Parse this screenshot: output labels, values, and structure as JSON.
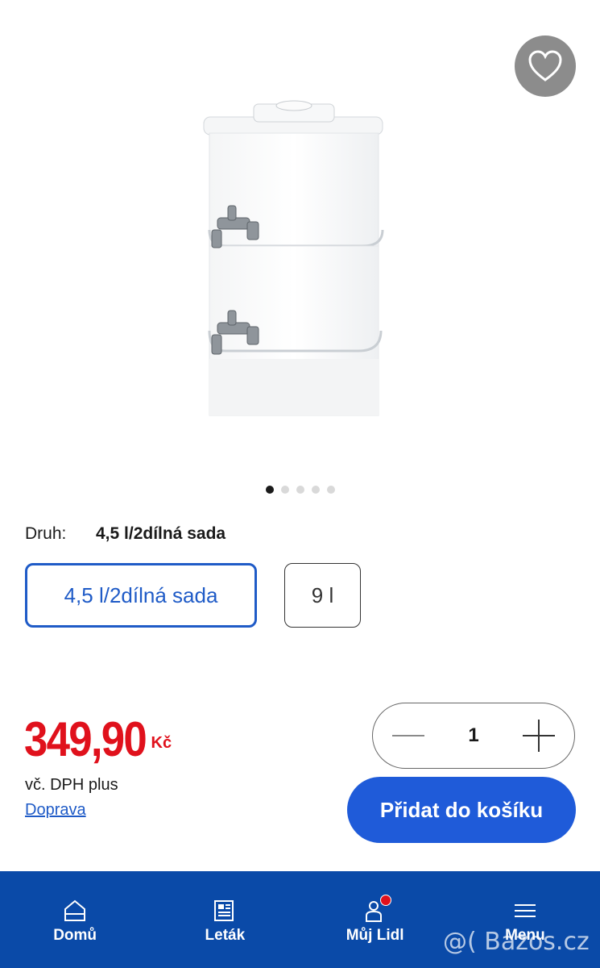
{
  "variant": {
    "label": "Druh:",
    "selected_value": "4,5 l/2dílná sada",
    "options": [
      "4,5 l/2dílná sada",
      "9 l"
    ]
  },
  "price": {
    "value": "349,90",
    "currency": "Kč",
    "vat_note": "vč. DPH plus",
    "shipping_link": "Doprava"
  },
  "quantity": {
    "value": "1"
  },
  "cart": {
    "add_label": "Přidat do košíku"
  },
  "gallery": {
    "slide_count": 5,
    "active_slide": 1
  },
  "nav": {
    "items": [
      {
        "label": "Domů",
        "icon": "home-icon"
      },
      {
        "label": "Leták",
        "icon": "flyer-icon"
      },
      {
        "label": "Můj Lidl",
        "icon": "user-icon"
      },
      {
        "label": "Menu",
        "icon": "menu-icon"
      }
    ]
  },
  "watermark": "@( Bazos.cz",
  "colors": {
    "accent": "#1f5bd9",
    "price": "#e0111c",
    "nav_bg": "#0a4aa8"
  }
}
